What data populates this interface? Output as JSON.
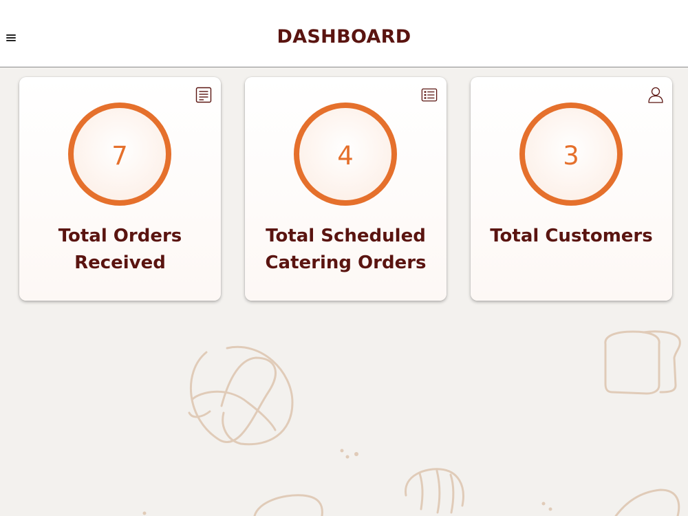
{
  "header": {
    "title": "DASHBOARD",
    "menu_icon": "hamburger-menu-icon"
  },
  "colors": {
    "title": "#5a1410",
    "accent": "#e5702c",
    "background": "#f3f1ee"
  },
  "cards": [
    {
      "value": "7",
      "label": "Total Orders Received",
      "icon": "orders-list-icon"
    },
    {
      "value": "4",
      "label": "Total Scheduled Catering Orders",
      "icon": "checklist-icon"
    },
    {
      "value": "3",
      "label": "Total Customers",
      "icon": "user-icon"
    }
  ]
}
